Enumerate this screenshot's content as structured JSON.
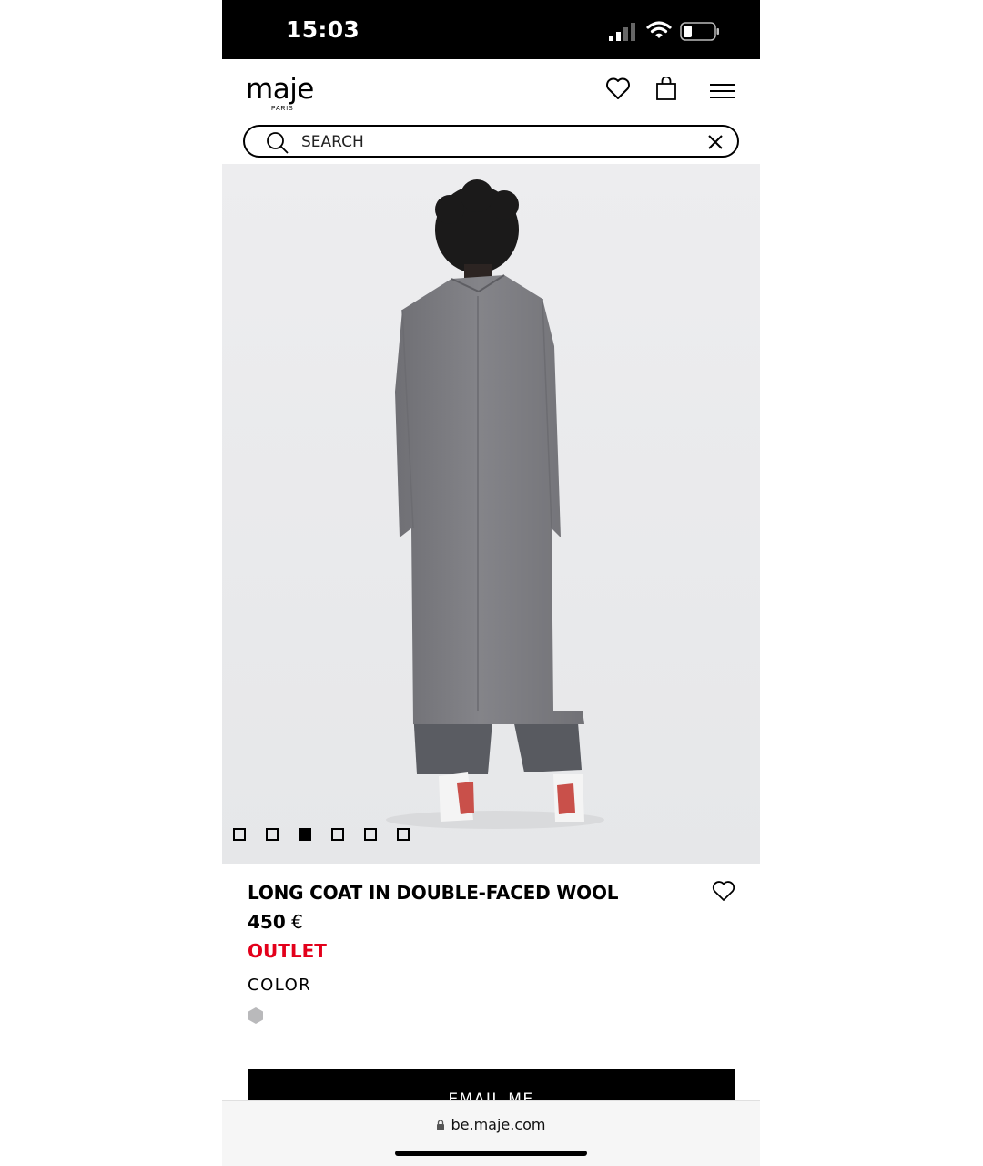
{
  "status_bar": {
    "time": "15:03"
  },
  "header": {
    "logo": "maje",
    "logo_sub": "PARIS"
  },
  "search": {
    "placeholder": "SEARCH"
  },
  "carousel": {
    "total": 6,
    "active_index": 2
  },
  "product": {
    "title": "LONG COAT IN DOUBLE-FACED WOOL",
    "price": "450",
    "currency": "€",
    "badge": "OUTLET",
    "color_label": "COLOR",
    "swatch_color": "#b9b9bb",
    "cta_label": "EMAIL ME"
  },
  "browser": {
    "url": "be.maje.com"
  },
  "colors": {
    "outlet": "#e3001b",
    "image_bg": "#ecedef",
    "coat": "#7c7c80"
  },
  "icons": [
    "signal-icon",
    "wifi-icon",
    "battery-icon",
    "heart-icon",
    "shopping-bag-icon",
    "menu-icon",
    "search-icon",
    "close-icon",
    "lock-icon"
  ]
}
